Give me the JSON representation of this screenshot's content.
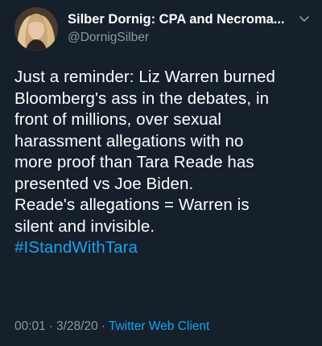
{
  "tweet": {
    "author": {
      "display_name": "Silber Dornig: CPA and Necroma...",
      "handle": "@DornigSilber"
    },
    "body_lines": [
      "Just a reminder:  Liz Warren burned",
      "Bloomberg's ass in the debates, in",
      "front of millions, over sexual",
      "harassment allegations with no",
      "more proof than Tara Reade has",
      "presented vs Joe Biden.",
      "Reade's allegations = Warren is",
      "silent and invisible."
    ],
    "hashtag": "#IStandWithTara",
    "time": "00:01",
    "date": "3/28/20",
    "separator": "·",
    "client": "Twitter Web Client"
  },
  "icons": {
    "more": "chevron-down-icon",
    "avatar": "avatar"
  },
  "colors": {
    "background": "#15202b",
    "text": "#ffffff",
    "secondary": "#8899a6",
    "accent": "#1da1f2"
  }
}
